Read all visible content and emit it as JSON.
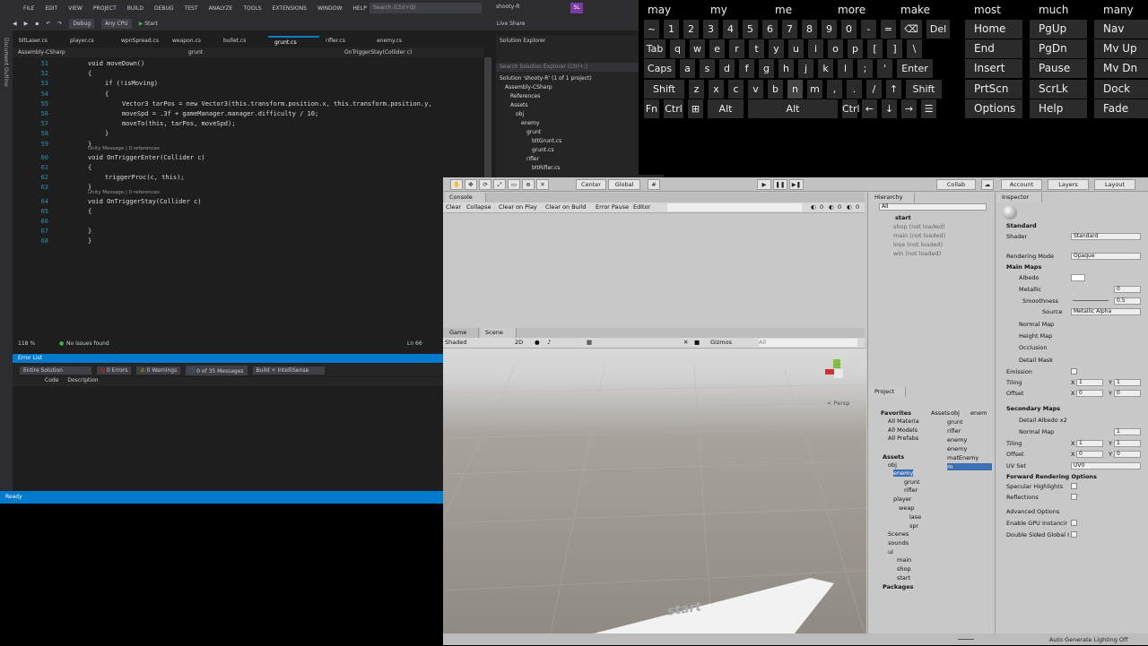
{
  "vs": {
    "menu": [
      "FILE",
      "EDIT",
      "VIEW",
      "PROJECT",
      "BUILD",
      "DEBUG",
      "TEST",
      "ANALYZE",
      "TOOLS",
      "EXTENSIONS",
      "WINDOW",
      "HELP"
    ],
    "search_placeholder": "Search (Ctrl+Q)",
    "solution_name": "shooty-R",
    "avatar": "SL",
    "toolbar": {
      "config": "Debug",
      "platform": "Any CPU",
      "start": "Start",
      "live_share": "Live Share"
    },
    "left_strip": "Document Outline",
    "tabs": [
      "bltLaser.cs",
      "player.cs",
      "wpnSpread.cs",
      "weapon.cs",
      "bullet.cs",
      "grunt.cs",
      "rifler.cs",
      "enemy.cs"
    ],
    "nav": [
      "Assembly-CSharp",
      "grunt",
      "OnTriggerStay(Collider c)"
    ],
    "lines": [
      {
        "n": "51",
        "t": "void moveDown()"
      },
      {
        "n": "52",
        "t": "{"
      },
      {
        "n": "53",
        "t": "if (!isMoving)"
      },
      {
        "n": "54",
        "t": "{"
      },
      {
        "n": "55",
        "t": "Vector3 tarPos = new Vector3(this.transform.position.x, this.transform.position.y,"
      },
      {
        "n": "56",
        "t": "moveSpd = .3f + gameManager.manager.difficulty / 10;"
      },
      {
        "n": "57",
        "t": "moveTo(this, tarPos, moveSpd);"
      },
      {
        "n": "58",
        "t": "}"
      },
      {
        "n": "59",
        "t": "}"
      },
      {
        "n": "60",
        "t": "void OnTriggerEnter(Collider c)"
      },
      {
        "n": "61",
        "t": "{"
      },
      {
        "n": "62",
        "t": "triggerProc(c, this);"
      },
      {
        "n": "63",
        "t": "}"
      },
      {
        "n": "64",
        "t": "void OnTriggerStay(Collider c)"
      },
      {
        "n": "65",
        "t": "{"
      },
      {
        "n": "66",
        "t": ""
      },
      {
        "n": "67",
        "t": "}"
      },
      {
        "n": "68",
        "t": "}"
      }
    ],
    "hint": "Unity Message | 0 references",
    "zoom": "118 %",
    "issues": "No issues found",
    "line_col": "Ln 66",
    "errorlist": {
      "title": "Error List",
      "scope": "Entire Solution",
      "errors": "0 Errors",
      "warnings": "0 Warnings",
      "messages": "0 of 35 Messages",
      "build": "Build + IntelliSense",
      "col_code": "Code",
      "col_desc": "Description"
    },
    "status": "Ready",
    "solution_explorer": {
      "title": "Solution Explorer",
      "search": "Search Solution Explorer (Ctrl+;)",
      "items": [
        "Solution 'shooty-R' (1 of 1 project)",
        "Assembly-CSharp",
        "References",
        "Assets",
        "obj",
        "enemy",
        "grunt",
        "bltGrunt.cs",
        "grunt.cs",
        "rifler",
        "bltRifler.cs"
      ]
    }
  },
  "keyboard": {
    "words": [
      "may",
      "my",
      "me",
      "more",
      "make",
      "most",
      "much",
      "many"
    ],
    "row1": [
      "~",
      "1",
      "2",
      "3",
      "4",
      "5",
      "6",
      "7",
      "8",
      "9",
      "0",
      "-",
      "=",
      "⌫",
      "Del"
    ],
    "row2": [
      "Tab",
      "q",
      "w",
      "e",
      "r",
      "t",
      "y",
      "u",
      "i",
      "o",
      "p",
      "[",
      "]",
      "\\"
    ],
    "row3": [
      "Caps",
      "a",
      "s",
      "d",
      "f",
      "g",
      "h",
      "j",
      "k",
      "l",
      ";",
      "'",
      "Enter"
    ],
    "row4": [
      "Shift",
      "z",
      "x",
      "c",
      "v",
      "b",
      "n",
      "m",
      ",",
      ".",
      "/",
      "↑",
      "Shift"
    ],
    "row5": [
      "Fn",
      "Ctrl",
      "⊞",
      "Alt",
      "Alt",
      "Ctrl",
      "←",
      "↓",
      "→",
      "☰"
    ],
    "nav": [
      [
        "Home",
        "Nav"
      ],
      [
        "End",
        "PgDn",
        "Mv Up"
      ],
      [
        "Insert",
        "Pause",
        "Mv Dn"
      ],
      [
        "PrtScn",
        "ScrLk",
        "Dock"
      ],
      [
        "Options",
        "Help",
        "Fade"
      ]
    ],
    "pgup": "PgUp"
  },
  "unity": {
    "toolbar": {
      "center": "Center",
      "global": "Global",
      "collab": "Collab",
      "account": "Account",
      "layers": "Layers",
      "layout": "Layout"
    },
    "console": {
      "tab": "Console",
      "buttons": [
        "Clear",
        "Collapse",
        "Clear on Play",
        "Clear on Build",
        "Error Pause",
        "Editor"
      ],
      "counts": [
        "0",
        "0",
        "0"
      ]
    },
    "scene": {
      "tabs": [
        "Game",
        "Scene"
      ],
      "shading": "Shaded",
      "mode": "2D",
      "gizmos": "Gizmos",
      "all": "All",
      "persp": "< Persp",
      "start_label": "start"
    },
    "hierarchy": {
      "title": "Hierarchy",
      "search": "All",
      "items": [
        "start",
        "shop (not loaded)",
        "main (not loaded)",
        "lose (not loaded)",
        "win (not loaded)"
      ]
    },
    "project": {
      "title": "Project",
      "favorites": [
        "Favorites",
        "All Materia",
        "All Models",
        "All Prefabs"
      ],
      "tree": [
        "Assets",
        "obj",
        "enemy",
        "grunt",
        "rifler",
        "player",
        "weap",
        "lase",
        "spr",
        "Scenes",
        "sounds",
        "ui",
        "main",
        "shop",
        "start",
        "Packages"
      ],
      "breadcrumb": [
        "Assets",
        "obj",
        "enem"
      ],
      "files": [
        "grunt",
        "rifler",
        "enemy",
        "enemy",
        "matEnemy",
        "m"
      ]
    },
    "inspector": {
      "title": "Inspector",
      "material": "Standard",
      "shader_label": "Shader",
      "shader": "Standard",
      "rendering_mode_label": "Rendering Mode",
      "rendering_mode": "Opaque",
      "main_maps": "Main Maps",
      "albedo": "Albedo",
      "metallic": "Metallic",
      "metallic_val": "0",
      "smoothness": "Smoothness",
      "smoothness_val": "0.5",
      "source": "Source",
      "source_val": "Metallic Alpha",
      "normal_map": "Normal Map",
      "height_map": "Height Map",
      "occlusion": "Occlusion",
      "detail_mask": "Detail Mask",
      "emission": "Emission",
      "tiling": "Tiling",
      "offset": "Offset",
      "x": "X",
      "y": "Y",
      "one": "1",
      "zero": "0",
      "secondary_maps": "Secondary Maps",
      "detail_albedo": "Detail Albedo x2",
      "normal_map2": "Normal Map",
      "normal_val": "1",
      "uv_set": "UV Set",
      "uv_val": "UV0",
      "forward": "Forward Rendering Options",
      "specular": "Specular Highlights",
      "reflections": "Reflections",
      "advanced": "Advanced Options",
      "gpu": "Enable GPU Instancir",
      "double": "Double Sided Global I",
      "footer": "Standard"
    },
    "status": "Auto Generate Lighting Off"
  }
}
